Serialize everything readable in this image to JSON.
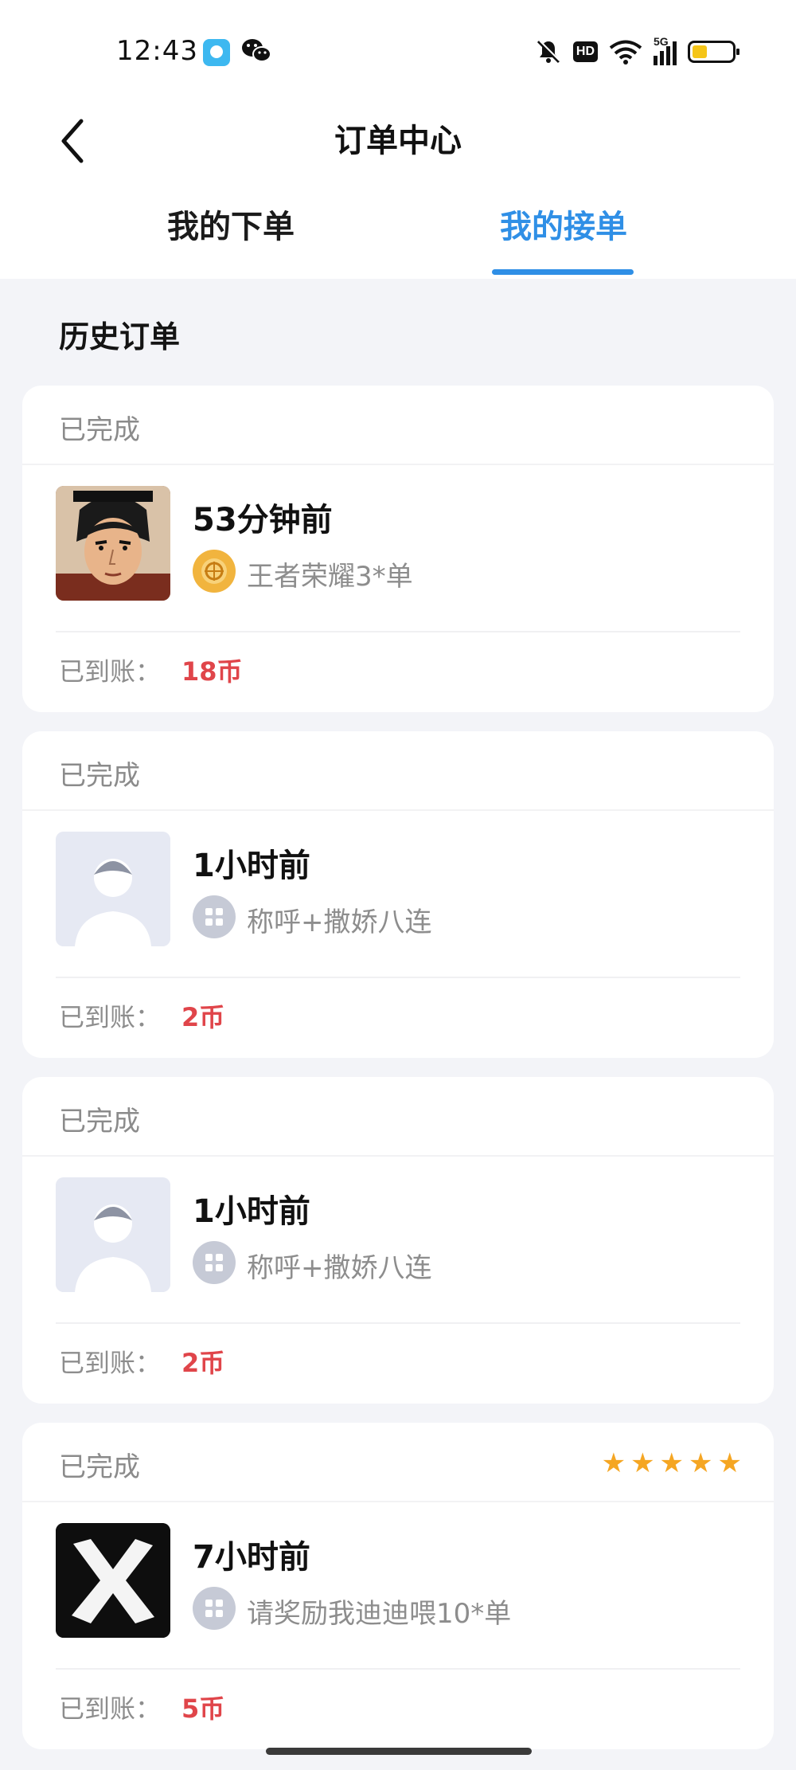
{
  "status_bar": {
    "time": "12:43",
    "network": "5G",
    "hd_badge": "HD",
    "battery_color": "#f5c518"
  },
  "header": {
    "title": "订单中心",
    "back_icon": "chevron-left-icon"
  },
  "tabs": [
    {
      "label": "我的下单",
      "active": false
    },
    {
      "label": "我的接单",
      "active": true
    }
  ],
  "accent_color": "#2f8fe6",
  "section": {
    "title": "历史订单"
  },
  "orders": [
    {
      "status": "已完成",
      "time": "53分钟前",
      "service": "王者荣耀3*单",
      "service_icon": "game-emblem-icon",
      "avatar": "anime-man-avatar",
      "paid_label": "已到账：",
      "paid_value": "18币",
      "rating_stars": 0
    },
    {
      "status": "已完成",
      "time": "1小时前",
      "service": "称呼+撒娇八连",
      "service_icon": "grid-icon",
      "avatar": "default-user-avatar",
      "paid_label": "已到账：",
      "paid_value": "2币",
      "rating_stars": 0
    },
    {
      "status": "已完成",
      "time": "1小时前",
      "service": "称呼+撒娇八连",
      "service_icon": "grid-icon",
      "avatar": "default-user-avatar",
      "paid_label": "已到账：",
      "paid_value": "2币",
      "rating_stars": 0
    },
    {
      "status": "已完成",
      "time": "7小时前",
      "service": "请奖励我迪迪喂10*单",
      "service_icon": "grid-icon",
      "avatar": "x-mark-avatar",
      "paid_label": "已到账：",
      "paid_value": "5币",
      "rating_stars": 5
    }
  ]
}
